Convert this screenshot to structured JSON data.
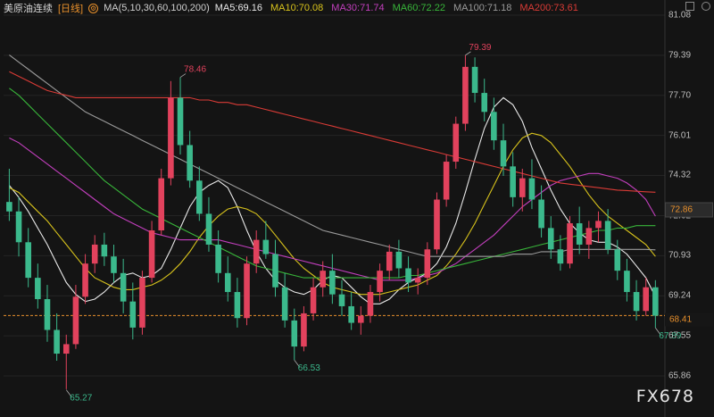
{
  "header": {
    "symbol": "美原油连续",
    "period": "[日线]",
    "ma_params": "MA(5,10,30,60,100,200)",
    "ma_values": [
      {
        "label": "MA5:69.16",
        "color": "#e9e9e9"
      },
      {
        "label": "MA10:70.08",
        "color": "#d7c21c"
      },
      {
        "label": "MA30:71.74",
        "color": "#c23fbd"
      },
      {
        "label": "MA60:72.22",
        "color": "#38b53a"
      },
      {
        "label": "MA100:71.18",
        "color": "#9a9a9a"
      },
      {
        "label": "MA200:73.61",
        "color": "#d93b36"
      }
    ]
  },
  "axis": {
    "ticks": [
      "81.08",
      "79.39",
      "77.70",
      "76.01",
      "74.32",
      "72.62",
      "70.93",
      "69.24",
      "67.55",
      "65.86"
    ],
    "last_price_tag": "72.86",
    "current_price_tag": "68.41"
  },
  "annotations": {
    "high_1": "78.46",
    "high_2": "79.39",
    "low_1": "65.27",
    "low_2": "66.53",
    "last_low": "67.89"
  },
  "watermark": "FX678",
  "colors": {
    "up": "#e2425d",
    "down": "#3bb98c",
    "background": "#141414",
    "current_line": "#e8902c"
  },
  "chart_data": {
    "type": "candlestick",
    "ylim": [
      64.6,
      81.4
    ],
    "current_price": 68.41,
    "candles": [
      [
        73.2,
        74.6,
        72.4,
        72.8
      ],
      [
        72.8,
        73.4,
        70.9,
        71.5
      ],
      [
        71.5,
        72.1,
        69.6,
        70.0
      ],
      [
        70.0,
        70.6,
        68.7,
        69.1
      ],
      [
        69.1,
        69.7,
        67.3,
        67.8
      ],
      [
        67.8,
        68.5,
        66.5,
        66.8
      ],
      [
        66.8,
        67.6,
        65.3,
        67.2
      ],
      [
        67.2,
        69.7,
        67.0,
        69.2
      ],
      [
        69.2,
        71.0,
        68.9,
        70.6
      ],
      [
        70.6,
        71.8,
        70.2,
        71.4
      ],
      [
        71.4,
        71.9,
        70.5,
        70.9
      ],
      [
        70.9,
        71.4,
        69.8,
        70.2
      ],
      [
        70.2,
        70.8,
        68.5,
        69.0
      ],
      [
        69.0,
        69.8,
        67.4,
        67.9
      ],
      [
        67.9,
        70.3,
        67.6,
        70.0
      ],
      [
        70.0,
        72.4,
        69.8,
        72.0
      ],
      [
        72.0,
        74.6,
        71.8,
        74.2
      ],
      [
        74.2,
        78.3,
        73.9,
        77.6
      ],
      [
        77.6,
        78.46,
        75.2,
        75.6
      ],
      [
        75.6,
        76.2,
        73.8,
        74.1
      ],
      [
        74.1,
        74.7,
        72.4,
        72.7
      ],
      [
        72.7,
        73.4,
        71.1,
        71.4
      ],
      [
        71.4,
        72.0,
        69.8,
        70.2
      ],
      [
        70.2,
        70.9,
        69.0,
        69.4
      ],
      [
        69.4,
        70.0,
        67.9,
        68.3
      ],
      [
        68.3,
        70.9,
        68.0,
        70.6
      ],
      [
        70.6,
        72.0,
        70.2,
        71.6
      ],
      [
        71.6,
        72.4,
        70.8,
        71.0
      ],
      [
        71.0,
        71.6,
        69.2,
        69.6
      ],
      [
        69.6,
        70.2,
        67.9,
        68.2
      ],
      [
        68.2,
        68.7,
        66.53,
        67.1
      ],
      [
        67.1,
        68.8,
        66.9,
        68.5
      ],
      [
        68.5,
        70.0,
        68.2,
        69.6
      ],
      [
        69.6,
        70.7,
        69.2,
        70.3
      ],
      [
        70.3,
        71.0,
        68.9,
        69.3
      ],
      [
        69.3,
        69.9,
        68.4,
        68.8
      ],
      [
        68.8,
        69.4,
        67.8,
        68.1
      ],
      [
        68.1,
        68.8,
        67.6,
        68.4
      ],
      [
        68.4,
        69.7,
        68.1,
        69.4
      ],
      [
        69.4,
        70.6,
        69.0,
        70.3
      ],
      [
        70.3,
        71.4,
        69.9,
        71.1
      ],
      [
        71.1,
        71.6,
        70.0,
        70.4
      ],
      [
        70.4,
        70.9,
        69.4,
        69.8
      ],
      [
        69.8,
        70.4,
        69.3,
        70.0
      ],
      [
        70.0,
        71.5,
        69.7,
        71.2
      ],
      [
        71.2,
        73.6,
        71.0,
        73.3
      ],
      [
        73.3,
        75.2,
        73.0,
        74.9
      ],
      [
        74.9,
        76.8,
        74.6,
        76.5
      ],
      [
        76.5,
        79.39,
        76.2,
        78.9
      ],
      [
        78.9,
        79.3,
        77.4,
        77.8
      ],
      [
        77.8,
        78.4,
        76.6,
        77.0
      ],
      [
        77.0,
        77.6,
        75.4,
        75.8
      ],
      [
        75.8,
        76.5,
        74.3,
        74.7
      ],
      [
        74.7,
        75.3,
        73.0,
        73.4
      ],
      [
        73.4,
        74.6,
        72.8,
        74.2
      ],
      [
        74.2,
        75.0,
        72.9,
        73.3
      ],
      [
        73.3,
        73.9,
        71.7,
        72.1
      ],
      [
        72.1,
        72.6,
        70.8,
        71.2
      ],
      [
        71.2,
        71.8,
        70.3,
        70.6
      ],
      [
        70.6,
        72.6,
        70.4,
        72.3
      ],
      [
        72.3,
        73.0,
        71.0,
        71.4
      ],
      [
        71.4,
        72.4,
        70.8,
        72.1
      ],
      [
        72.1,
        72.8,
        71.5,
        72.4
      ],
      [
        72.4,
        72.9,
        71.0,
        71.2
      ],
      [
        71.2,
        71.6,
        69.9,
        70.3
      ],
      [
        70.3,
        70.8,
        69.0,
        69.4
      ],
      [
        69.4,
        69.9,
        68.2,
        68.6
      ],
      [
        68.6,
        70.0,
        68.4,
        69.6
      ],
      [
        69.6,
        69.9,
        67.89,
        68.4
      ]
    ],
    "moving_averages": [
      {
        "name": "MA5",
        "color": "#e9e9e9",
        "values": [
          73.9,
          73.4,
          72.8,
          72.1,
          71.4,
          70.6,
          69.8,
          69.3,
          69.0,
          69.1,
          69.4,
          69.8,
          70.1,
          70.2,
          70.0,
          70.1,
          70.4,
          71.2,
          72.1,
          73.0,
          73.6,
          73.9,
          74.1,
          73.8,
          73.0,
          72.0,
          71.1,
          70.4,
          69.9,
          69.6,
          69.4,
          69.3,
          69.5,
          69.9,
          70.1,
          70.0,
          69.6,
          69.2,
          68.9,
          68.9,
          69.1,
          69.5,
          69.8,
          70.0,
          70.2,
          70.6,
          71.3,
          72.3,
          73.6,
          75.0,
          76.3,
          77.2,
          77.6,
          77.3,
          76.6,
          75.5,
          74.6,
          73.7,
          72.9,
          72.3,
          71.9,
          71.6,
          71.5,
          71.5,
          71.3,
          71.0,
          70.5,
          70.0,
          69.2
        ]
      },
      {
        "name": "MA10",
        "color": "#d7c21c",
        "values": [
          73.8,
          73.6,
          73.2,
          72.8,
          72.4,
          71.9,
          71.4,
          70.9,
          70.4,
          70.0,
          69.8,
          69.6,
          69.5,
          69.5,
          69.6,
          69.7,
          69.9,
          70.2,
          70.6,
          71.1,
          71.7,
          72.2,
          72.6,
          72.9,
          73.0,
          72.9,
          72.7,
          72.3,
          71.8,
          71.3,
          70.8,
          70.4,
          70.1,
          69.8,
          69.6,
          69.5,
          69.4,
          69.3,
          69.3,
          69.3,
          69.4,
          69.5,
          69.6,
          69.7,
          69.9,
          70.1,
          70.5,
          71.0,
          71.6,
          72.3,
          73.1,
          73.9,
          74.7,
          75.4,
          75.9,
          76.1,
          76.0,
          75.7,
          75.2,
          74.7,
          74.1,
          73.5,
          73.0,
          72.6,
          72.3,
          72.0,
          71.7,
          71.4,
          70.9
        ]
      },
      {
        "name": "MA30",
        "color": "#c23fbd",
        "values": [
          75.9,
          75.7,
          75.4,
          75.1,
          74.8,
          74.5,
          74.2,
          73.9,
          73.6,
          73.3,
          73.0,
          72.7,
          72.5,
          72.3,
          72.1,
          71.9,
          71.8,
          71.7,
          71.6,
          71.6,
          71.6,
          71.6,
          71.6,
          71.5,
          71.4,
          71.3,
          71.2,
          71.1,
          71.0,
          70.9,
          70.8,
          70.7,
          70.6,
          70.5,
          70.4,
          70.3,
          70.2,
          70.1,
          70.0,
          69.9,
          69.9,
          69.9,
          69.9,
          70.0,
          70.1,
          70.2,
          70.4,
          70.6,
          70.9,
          71.2,
          71.5,
          71.8,
          72.2,
          72.6,
          73.0,
          73.3,
          73.6,
          73.9,
          74.1,
          74.2,
          74.3,
          74.4,
          74.4,
          74.3,
          74.2,
          74.0,
          73.7,
          73.3,
          72.6
        ]
      },
      {
        "name": "MA60",
        "color": "#38b53a",
        "values": [
          78.0,
          77.7,
          77.3,
          76.9,
          76.5,
          76.1,
          75.7,
          75.3,
          74.9,
          74.5,
          74.1,
          73.8,
          73.5,
          73.2,
          72.9,
          72.7,
          72.5,
          72.3,
          72.1,
          71.9,
          71.7,
          71.5,
          71.3,
          71.1,
          70.9,
          70.7,
          70.5,
          70.4,
          70.3,
          70.2,
          70.1,
          70.0,
          70.0,
          70.0,
          70.0,
          70.0,
          70.0,
          70.0,
          70.0,
          70.0,
          70.0,
          70.0,
          70.1,
          70.1,
          70.2,
          70.3,
          70.4,
          70.5,
          70.6,
          70.7,
          70.8,
          70.9,
          71.0,
          71.1,
          71.2,
          71.3,
          71.4,
          71.5,
          71.6,
          71.7,
          71.8,
          71.9,
          72.0,
          72.0,
          72.1,
          72.1,
          72.2,
          72.2,
          72.2
        ]
      },
      {
        "name": "MA100",
        "color": "#9a9a9a",
        "values": [
          79.4,
          79.1,
          78.8,
          78.5,
          78.2,
          77.9,
          77.6,
          77.3,
          77.0,
          76.8,
          76.6,
          76.4,
          76.2,
          76.0,
          75.8,
          75.6,
          75.4,
          75.2,
          75.0,
          74.8,
          74.6,
          74.4,
          74.2,
          74.0,
          73.8,
          73.6,
          73.4,
          73.2,
          73.0,
          72.8,
          72.6,
          72.4,
          72.2,
          72.0,
          71.9,
          71.8,
          71.7,
          71.6,
          71.5,
          71.4,
          71.3,
          71.2,
          71.1,
          71.0,
          70.9,
          70.9,
          70.9,
          70.9,
          70.9,
          70.9,
          70.9,
          70.9,
          70.9,
          71.0,
          71.0,
          71.0,
          71.1,
          71.1,
          71.1,
          71.2,
          71.2,
          71.2,
          71.2,
          71.2,
          71.2,
          71.2,
          71.2,
          71.2,
          71.18
        ]
      },
      {
        "name": "MA200",
        "color": "#d93b36",
        "values": [
          78.7,
          78.5,
          78.3,
          78.1,
          77.9,
          77.8,
          77.7,
          77.6,
          77.6,
          77.6,
          77.6,
          77.6,
          77.6,
          77.6,
          77.6,
          77.6,
          77.6,
          77.6,
          77.6,
          77.6,
          77.5,
          77.5,
          77.4,
          77.4,
          77.3,
          77.3,
          77.2,
          77.1,
          77.0,
          76.9,
          76.8,
          76.7,
          76.6,
          76.5,
          76.4,
          76.3,
          76.2,
          76.1,
          76.0,
          75.9,
          75.8,
          75.7,
          75.6,
          75.5,
          75.4,
          75.3,
          75.2,
          75.1,
          75.0,
          74.9,
          74.8,
          74.7,
          74.6,
          74.5,
          74.4,
          74.3,
          74.2,
          74.1,
          74.0,
          73.95,
          73.9,
          73.85,
          73.8,
          73.75,
          73.7,
          73.68,
          73.65,
          73.63,
          73.61
        ]
      }
    ]
  }
}
